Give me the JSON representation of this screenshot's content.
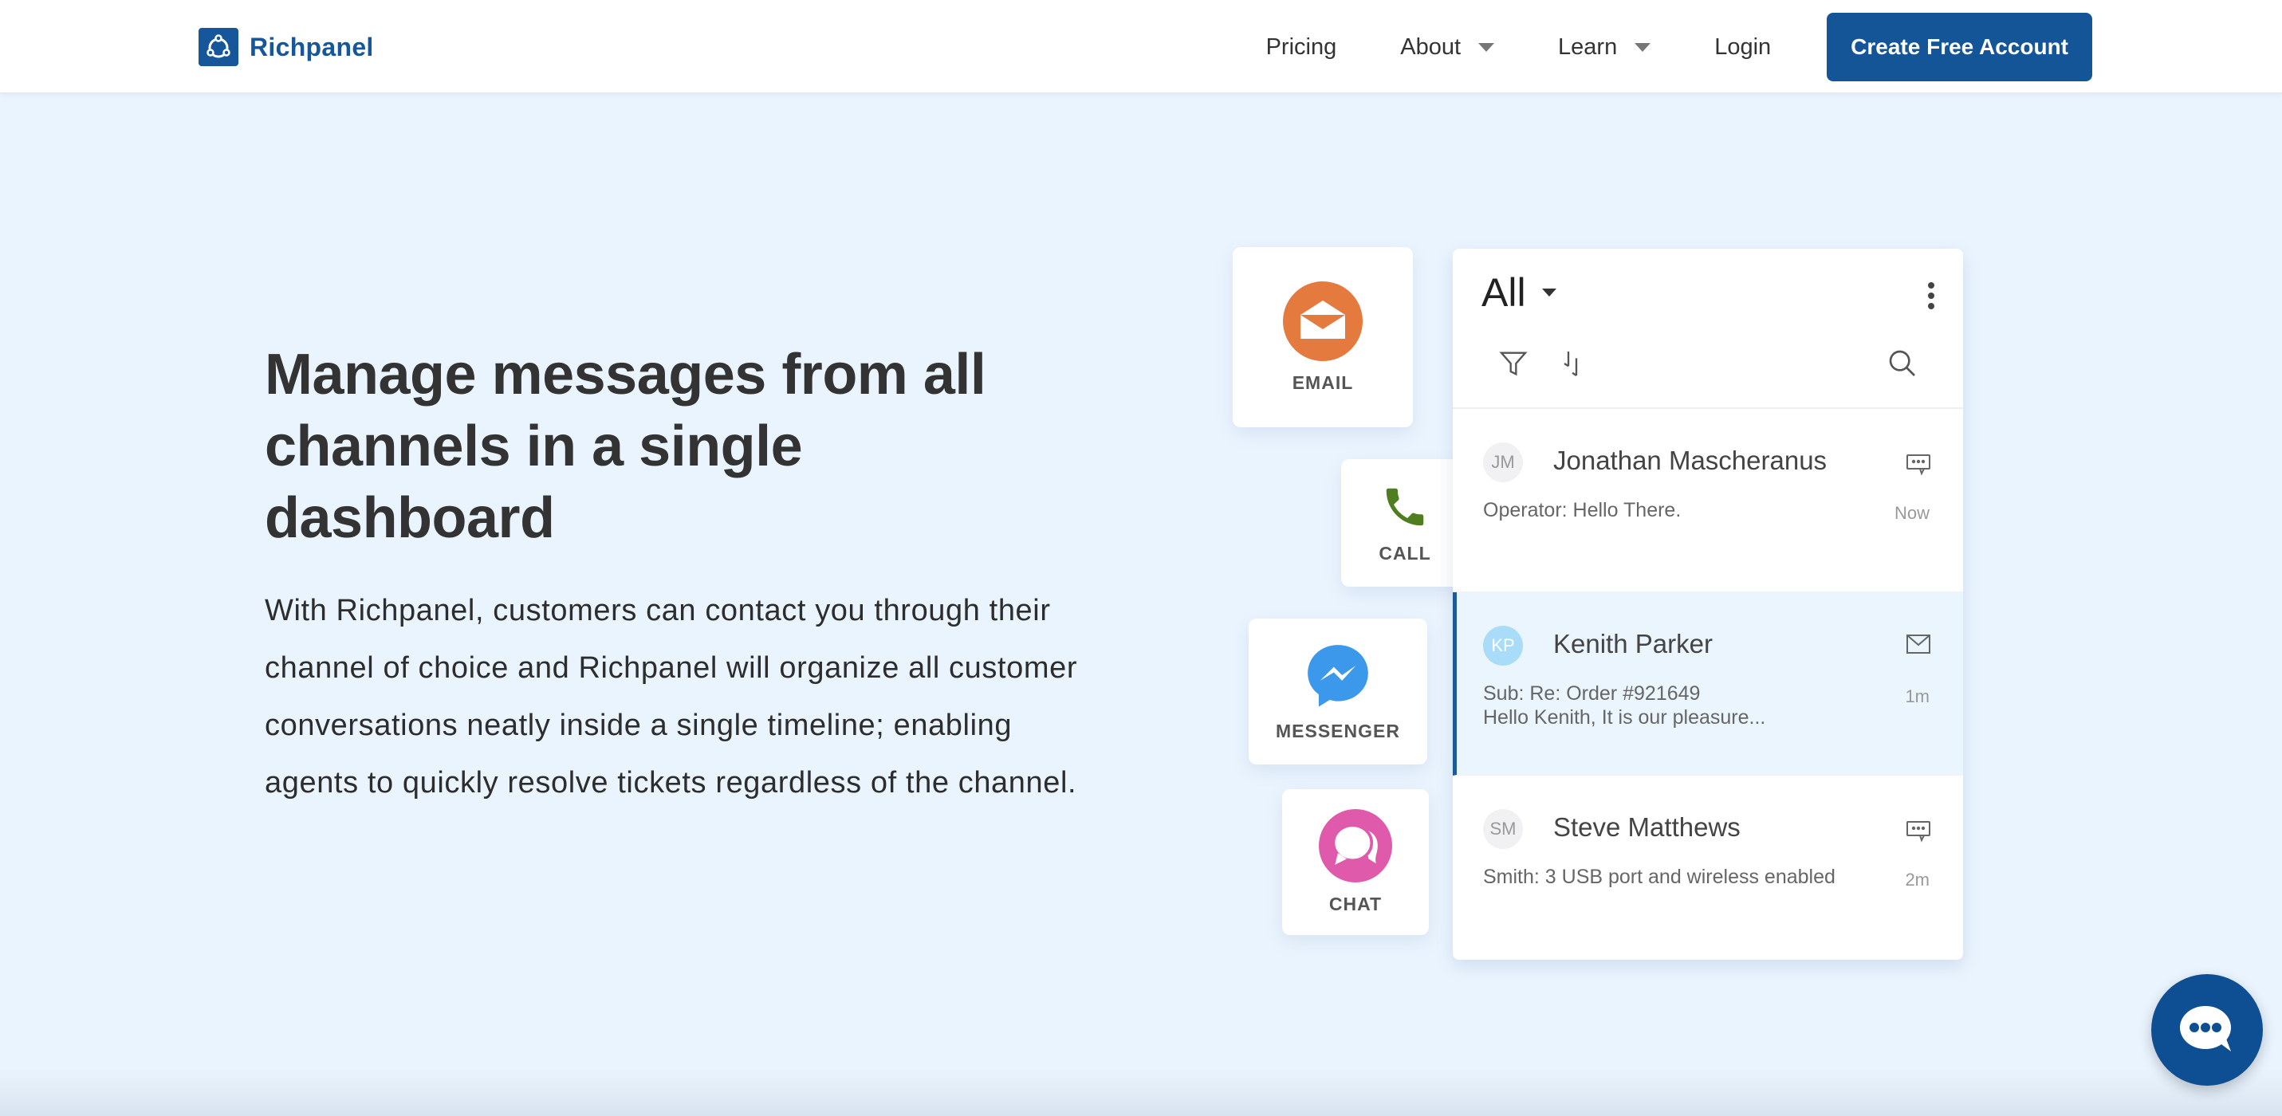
{
  "brand": {
    "name": "Richpanel",
    "color": "#15579a"
  },
  "nav": {
    "items": [
      {
        "label": "Pricing",
        "has_dropdown": false
      },
      {
        "label": "About",
        "has_dropdown": true
      },
      {
        "label": "Learn",
        "has_dropdown": true
      },
      {
        "label": "Login",
        "has_dropdown": false
      }
    ],
    "cta_label": "Create Free Account"
  },
  "hero": {
    "title": "Manage messages from all channels in a single dashboard",
    "body": "With Richpanel, customers can contact you through their channel of choice and Richpanel will organize all customer conversations neatly inside a single timeline; enabling agents to quickly resolve tickets regardless of the channel."
  },
  "channels": [
    {
      "label": "EMAIL",
      "icon": "email-icon",
      "color": "#e57a3f"
    },
    {
      "label": "CALL",
      "icon": "phone-icon",
      "color": "#4e7e1f"
    },
    {
      "label": "MESSENGER",
      "icon": "messenger-icon",
      "color": "#3b98ea"
    },
    {
      "label": "CHAT",
      "icon": "chat-bubbles-icon",
      "color": "#e05aab"
    }
  ],
  "inbox": {
    "filter_label": "All",
    "conversations": [
      {
        "initials": "JM",
        "name": "Jonathan Mascheranus",
        "preview": "Operator: Hello There.",
        "time": "Now",
        "channel_icon": "chat-icon",
        "active": false
      },
      {
        "initials": "KP",
        "name": "Kenith Parker",
        "preview": "Sub: Re: Order #921649\nHello Kenith, It is our pleasure...",
        "preview_line1": "Sub: Re: Order #921649",
        "preview_line2": "Hello Kenith, It is our pleasure...",
        "time": "1m",
        "channel_icon": "envelope-icon",
        "active": true
      },
      {
        "initials": "SM",
        "name": "Steve Matthews",
        "preview": "Smith: 3 USB port and wireless enabled",
        "time": "2m",
        "channel_icon": "chat-icon",
        "active": false
      }
    ]
  },
  "chat_widget": {
    "icon": "chat-bubble-icon",
    "color": "#0d4f92"
  }
}
